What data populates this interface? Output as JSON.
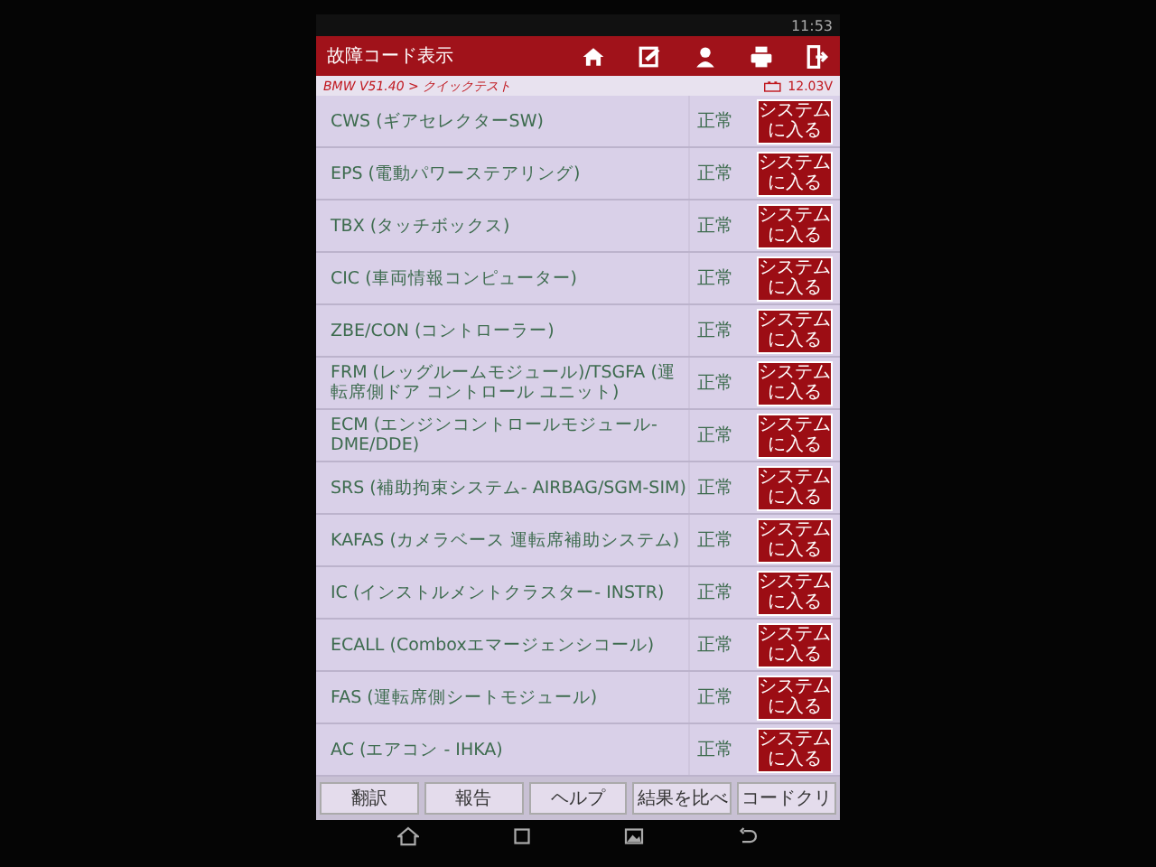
{
  "status_bar": {
    "time": "11:53"
  },
  "header": {
    "title": "故障コード表示"
  },
  "breadcrumb": {
    "path": "BMW V51.40 > クイックテスト",
    "voltage": "12.03V"
  },
  "rows": [
    {
      "name": "CWS (ギアセレクターSW)",
      "status": "正常",
      "action": "システムに入る"
    },
    {
      "name": "EPS (電動パワーステアリング)",
      "status": "正常",
      "action": "システムに入る"
    },
    {
      "name": "TBX (タッチボックス)",
      "status": "正常",
      "action": "システムに入る"
    },
    {
      "name": "CIC (車両情報コンピューター)",
      "status": "正常",
      "action": "システムに入る"
    },
    {
      "name": "ZBE/CON (コントローラー)",
      "status": "正常",
      "action": "システムに入る"
    },
    {
      "name": "FRM (レッグルームモジュール)/TSGFA (運転席側ドア コントロール ユニット)",
      "status": "正常",
      "action": "システムに入る"
    },
    {
      "name": "ECM (エンジンコントロールモジュール- DME/DDE)",
      "status": "正常",
      "action": "システムに入る"
    },
    {
      "name": "SRS (補助拘束システム- AIRBAG/SGM-SIM)",
      "status": "正常",
      "action": "システムに入る"
    },
    {
      "name": "KAFAS (カメラベース 運転席補助システム)",
      "status": "正常",
      "action": "システムに入る"
    },
    {
      "name": "IC (インストルメントクラスター- INSTR)",
      "status": "正常",
      "action": "システムに入る"
    },
    {
      "name": "ECALL (Comboxエマージェンシコール)",
      "status": "正常",
      "action": "システムに入る"
    },
    {
      "name": "FAS (運転席側シートモジュール)",
      "status": "正常",
      "action": "システムに入る"
    },
    {
      "name": "AC (エアコン - IHKA)",
      "status": "正常",
      "action": "システムに入る"
    }
  ],
  "toolbar": [
    "翻訳",
    "報告",
    "ヘルプ",
    "結果を比べ",
    "コードクリ"
  ]
}
